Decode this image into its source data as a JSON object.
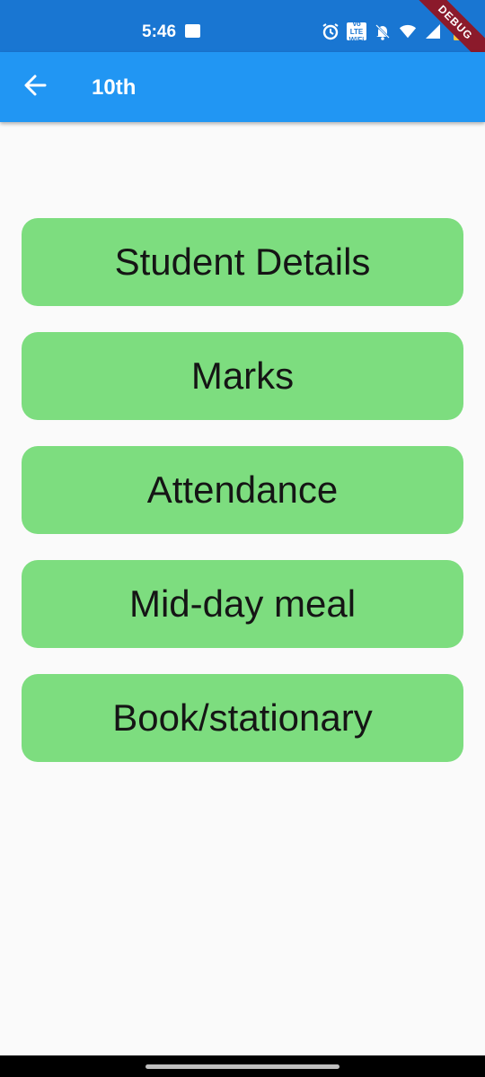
{
  "status_bar": {
    "time": "5:46",
    "volte_label": "Vo LTE WiFi",
    "debug_label": "DEBUG",
    "icons": [
      "gallery-icon",
      "alarm-icon",
      "volte-wifi-icon",
      "notifications-off-icon",
      "wifi-icon",
      "cell-signal-icon",
      "battery-icon"
    ]
  },
  "app_bar": {
    "title": "10th",
    "back_icon": "arrow-back-icon"
  },
  "menu": {
    "items": [
      {
        "label": "Student Details"
      },
      {
        "label": "Marks"
      },
      {
        "label": "Attendance"
      },
      {
        "label": "Mid-day meal"
      },
      {
        "label": "Book/stationary"
      }
    ]
  },
  "colors": {
    "status_bar": "#1976d2",
    "app_bar": "#2196f3",
    "button": "#7ddd7f",
    "background": "#fafafa"
  }
}
